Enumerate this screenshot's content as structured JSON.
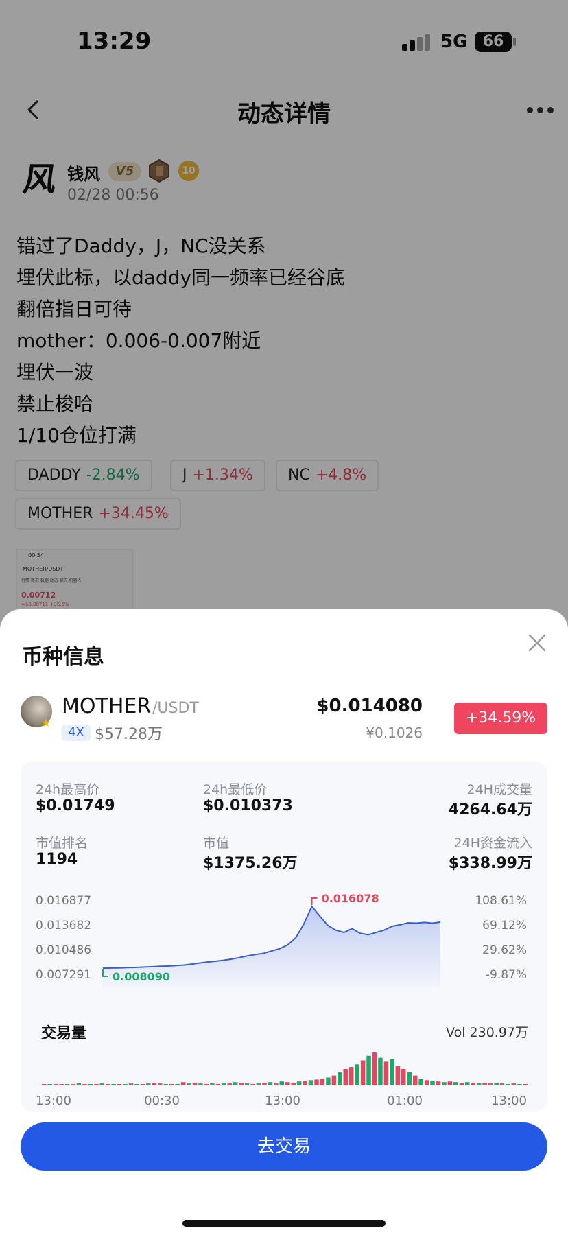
{
  "status_bar": {
    "time": "13:29",
    "network": "5G",
    "battery": "66"
  },
  "nav": {
    "title": "动态详情"
  },
  "author": {
    "avatar_glyph": "风",
    "name": "钱风",
    "vip_badge": "V5",
    "level_badge": "10",
    "post_time": "02/28 00:56"
  },
  "post": {
    "lines": [
      "错过了Daddy，J，NC没关系",
      "埋伏此标，以daddy同一频率已经谷底",
      "翻倍指日可待",
      "mother：0.006-0.007附近",
      "埋伏一波",
      "禁止梭哈",
      "1/10仓位打满"
    ]
  },
  "tags": [
    {
      "symbol": "DADDY",
      "change": "-2.84%",
      "direction": "down"
    },
    {
      "symbol": "J",
      "change": "+1.34%",
      "direction": "up"
    },
    {
      "symbol": "NC",
      "change": "+4.8%",
      "direction": "up"
    },
    {
      "symbol": "MOTHER",
      "change": "+34.45%",
      "direction": "up"
    }
  ],
  "thumbnail": {
    "time": "00:54",
    "pair": "MOTHER/USDT",
    "tabs": "行情 概况 数据 动态 聊天 机器人",
    "price": "0.00712",
    "sub": "≈$0.00711 +35.6%"
  },
  "sheet": {
    "title": "币种信息",
    "coin": {
      "symbol": "MOTHER",
      "quote": "/USDT",
      "leverage": "4X",
      "market_cap": "$57.28万",
      "price_usd": "$0.014080",
      "price_cny": "¥0.1026",
      "change": "+34.59%"
    },
    "stats": {
      "high_label": "24h最高价",
      "high_value": "$0.01749",
      "low_label": "24h最低价",
      "low_value": "$0.010373",
      "volume_label": "24H成交量",
      "volume_value": "4264.64万",
      "rank_label": "市值排名",
      "rank_value": "1194",
      "mcap_label": "市值",
      "mcap_value": "$1375.26万",
      "inflow_label": "24H资金流入",
      "inflow_value": "$338.99万"
    },
    "volume_title": "交易量",
    "volume_total": "Vol 230.97万",
    "trade_button": "去交易"
  },
  "colors": {
    "up": "#e5475f",
    "down": "#1fa86b",
    "accent": "#2459e6",
    "line": "#3b5fc4"
  },
  "chart_data": [
    {
      "type": "area",
      "y_ticks_left": [
        "0.016877",
        "0.013682",
        "0.010486",
        "0.007291"
      ],
      "y_ticks_right": [
        "108.61%",
        "69.12%",
        "29.62%",
        "-9.87%"
      ],
      "ylim": [
        0.007291,
        0.016877
      ],
      "high_label": "0.016078",
      "low_label": "0.008090",
      "values": [
        0.00809,
        0.0081,
        0.00812,
        0.00815,
        0.00818,
        0.00822,
        0.00827,
        0.00832,
        0.00836,
        0.00842,
        0.00848,
        0.0086,
        0.00875,
        0.00888,
        0.00898,
        0.0091,
        0.00925,
        0.00945,
        0.00968,
        0.00985,
        0.01,
        0.0103,
        0.0106,
        0.0111,
        0.012,
        0.0138,
        0.01608,
        0.0148,
        0.0136,
        0.013,
        0.0127,
        0.0132,
        0.0126,
        0.0124,
        0.0127,
        0.013,
        0.0135,
        0.0137,
        0.01395,
        0.0139,
        0.014,
        0.0139,
        0.01405
      ]
    },
    {
      "type": "bar",
      "title": "交易量",
      "x_ticks": [
        "13:00",
        "00:30",
        "13:00",
        "01:00",
        "13:00"
      ],
      "values": [
        1,
        1,
        2,
        1,
        2,
        1,
        3,
        2,
        1,
        2,
        3,
        2,
        1,
        2,
        1,
        3,
        2,
        2,
        3,
        4,
        3,
        2,
        1,
        2,
        5,
        3,
        4,
        3,
        2,
        3,
        2,
        4,
        3,
        5,
        4,
        3,
        2,
        3,
        4,
        5,
        3,
        6,
        5,
        4,
        6,
        7,
        8,
        9,
        10,
        12,
        15,
        20,
        25,
        28,
        32,
        38,
        45,
        50,
        42,
        36,
        40,
        30,
        25,
        20,
        15,
        10,
        8,
        7,
        6,
        5,
        6,
        5,
        4,
        5,
        4,
        3,
        4,
        3,
        4,
        3,
        2,
        3,
        2,
        2
      ],
      "up": [
        true,
        false,
        true,
        true,
        false,
        true,
        false,
        true,
        false,
        true,
        false,
        true,
        false,
        true,
        false,
        true,
        false,
        true,
        false,
        true,
        true,
        false,
        true,
        false,
        true,
        false,
        true,
        false,
        true,
        false,
        true,
        false,
        true,
        false,
        true,
        false,
        true,
        false,
        true,
        false,
        true,
        false,
        true,
        true,
        false,
        true,
        false,
        true,
        true,
        false,
        true,
        false,
        true,
        true,
        false,
        true,
        false,
        true,
        false,
        true,
        false,
        true,
        true,
        false,
        true,
        false,
        true,
        false,
        true,
        false,
        true,
        false,
        true,
        false,
        true,
        false,
        true,
        true,
        false,
        true,
        false,
        true,
        false,
        true
      ]
    }
  ]
}
